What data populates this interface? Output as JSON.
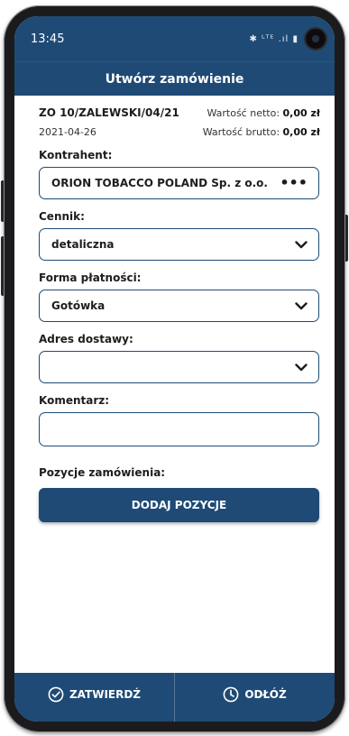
{
  "status_bar": {
    "time": "13:45",
    "icons_text": "✱ ᴸᵀᴱ .ıl ▮"
  },
  "header": {
    "title": "Utwórz zamówienie"
  },
  "document": {
    "number": "ZO 10/ZALEWSKI/04/21",
    "date": "2021-04-26",
    "net_label": "Wartość netto:",
    "net_value": "0,00 zł",
    "gross_label": "Wartość brutto:",
    "gross_value": "0,00 zł"
  },
  "fields": {
    "contractor": {
      "label": "Kontrahent:",
      "value": "ORION TOBACCO POLAND Sp. z o.o.",
      "more": "•••"
    },
    "price_list": {
      "label": "Cennik:",
      "value": "detaliczna"
    },
    "payment": {
      "label": "Forma płatności:",
      "value": "Gotówka"
    },
    "address": {
      "label": "Adres dostawy:",
      "value": ""
    },
    "comment": {
      "label": "Komentarz:",
      "value": ""
    }
  },
  "positions": {
    "label": "Pozycje zamówienia:",
    "add_button": "DODAJ POZYCJE"
  },
  "bottom_bar": {
    "confirm": "ZATWIERDŹ",
    "postpone": "ODŁÓŻ"
  },
  "colors": {
    "primary": "#1e4a75",
    "text": "#1d1d1d",
    "background": "#ffffff"
  }
}
